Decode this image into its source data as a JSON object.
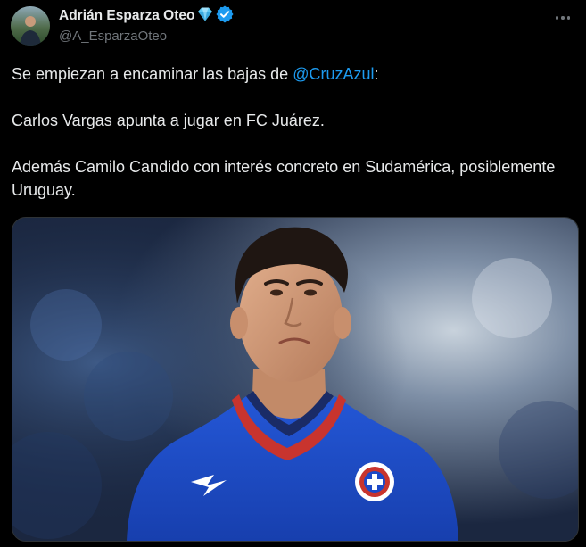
{
  "author": {
    "display_name": "Adrián Esparza Oteo",
    "handle": "@A_EsparzaOteo",
    "verified": true,
    "badge_icon": "diamond-emoji-icon",
    "verified_icon": "verified-badge-icon",
    "verified_color": "#1d9bf0"
  },
  "tweet": {
    "line1_before": "Se empiezan a encaminar las bajas de ",
    "line1_mention": "@CruzAzul",
    "line1_after": ":",
    "line2": "Carlos Vargas apunta a jugar en FC Juárez.",
    "line3": "Además Camilo Candido con interés concreto en Sudamérica, posiblemente Uruguay."
  },
  "actions": {
    "more_icon": "more-options-icon"
  },
  "colors": {
    "background": "#000000",
    "text": "#e7e9ea",
    "secondary_text": "#71767b",
    "link": "#1d9bf0",
    "jersey_blue": "#1c49c8",
    "collar_red": "#c8342e"
  }
}
